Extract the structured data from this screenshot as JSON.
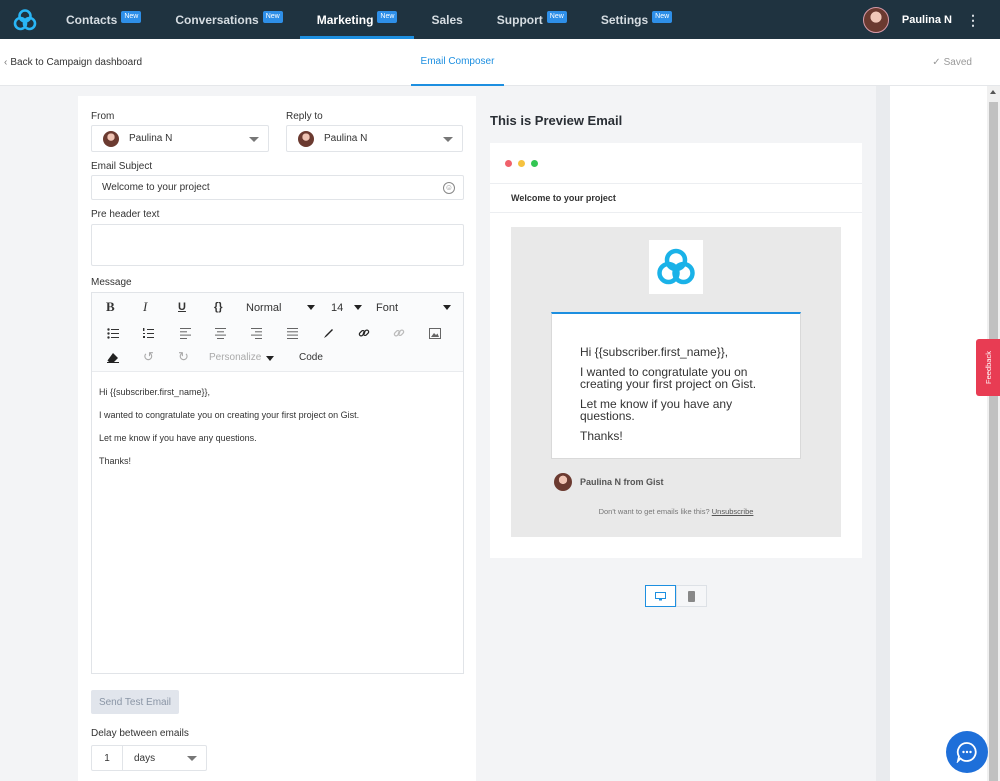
{
  "nav": {
    "items": [
      {
        "label": "Contacts",
        "badge": "New"
      },
      {
        "label": "Conversations",
        "badge": "New"
      },
      {
        "label": "Marketing",
        "badge": "New"
      },
      {
        "label": "Sales",
        "badge": ""
      },
      {
        "label": "Support",
        "badge": "New"
      },
      {
        "label": "Settings",
        "badge": "New"
      }
    ],
    "active": "Marketing",
    "user_name": "Paulina N",
    "menu_icon": "⋮",
    "accent_color": "#1d8fe0",
    "bar_color": "#1f3340"
  },
  "subheader": {
    "back_label": "Back to Campaign dashboard",
    "tab_label": "Email Composer",
    "saved_label": "Saved"
  },
  "form": {
    "from_label": "From",
    "from_value": "Paulina N",
    "reply_to_label": "Reply to",
    "reply_to_value": "Paulina N",
    "subject_label": "Email Subject",
    "subject_value": "Welcome to your project",
    "preheader_label": "Pre header text",
    "preheader_value": "",
    "message_label": "Message",
    "toolbar": {
      "bold": "B",
      "italic": "I",
      "underline": "U",
      "braces": "{}",
      "heading_select": "Normal",
      "size_select": "14",
      "font_select": "Font",
      "personalize_label": "Personalize",
      "code_label": "Code"
    },
    "message_lines": [
      "Hi {{subscriber.first_name}},",
      "I wanted to congratulate you on creating your first project on Gist.",
      "Let me know if you have any questions.",
      "Thanks!"
    ],
    "send_test_label": "Send Test Email",
    "delay_label": "Delay between emails",
    "delay_value": "1",
    "delay_unit": "days"
  },
  "preview": {
    "title": "This is Preview Email",
    "subject": "Welcome to your project",
    "body_lines": [
      "Hi {{subscriber.first_name}},",
      "I wanted to congratulate you on creating your first project on Gist.",
      "Let me know if you have any questions.",
      "Thanks!"
    ],
    "sender": "Paulina N from Gist",
    "unsubscribe_text": "Don't want to get emails like this?",
    "unsubscribe_link": "Unsubscribe",
    "dot_colors": [
      "#f0616b",
      "#f6c23e",
      "#33c653"
    ],
    "logo_color": "#1ab2e8"
  },
  "feedback_label": "Feedback",
  "chat_color": "#1e6fd9"
}
